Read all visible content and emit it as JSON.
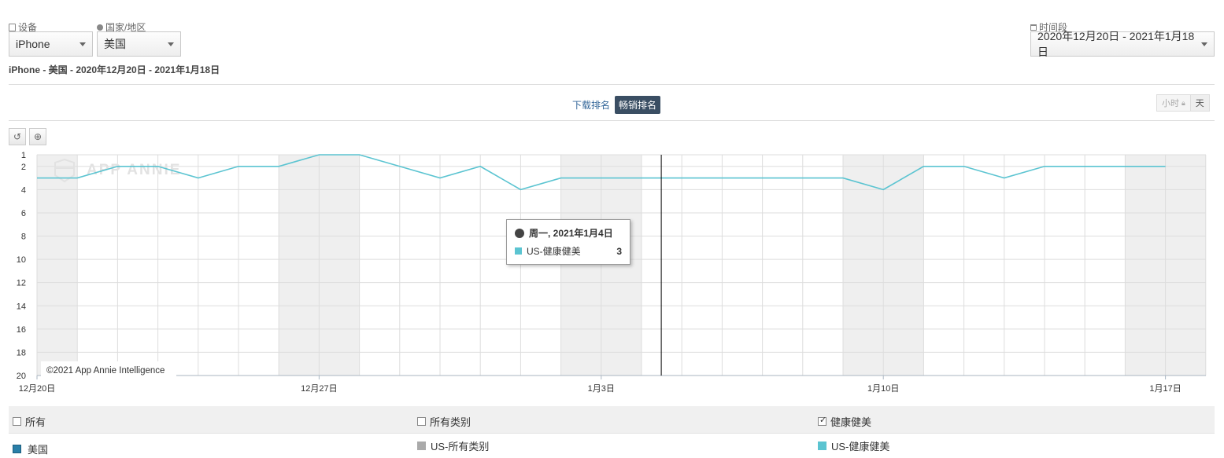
{
  "filters": {
    "device": {
      "label": "设备",
      "value": "iPhone"
    },
    "country": {
      "label": "国家/地区",
      "value": "美国"
    },
    "period": {
      "label": "时间段",
      "value": "2020年12月20日 - 2021年1月18日"
    }
  },
  "subtitle": "iPhone - 美国 - 2020年12月20日 - 2021年1月18日",
  "rank_toggle": {
    "downloads": "下载排名",
    "grossing": "畅销排名"
  },
  "granularity": {
    "hour": "小时",
    "day": "天"
  },
  "watermark": "APP ANNIE",
  "copyright": "©2021 App Annie Intelligence",
  "tooltip": {
    "date": "周一, 2021年1月4日",
    "series": "US-健康健美",
    "value": "3"
  },
  "colors": {
    "series": "#5bc4d1",
    "accent": "#3a4e63"
  },
  "chart_data": {
    "type": "line",
    "x": [
      "2020-12-20",
      "2020-12-21",
      "2020-12-22",
      "2020-12-23",
      "2020-12-24",
      "2020-12-25",
      "2020-12-26",
      "2020-12-27",
      "2020-12-28",
      "2020-12-29",
      "2020-12-30",
      "2020-12-31",
      "2021-01-01",
      "2021-01-02",
      "2021-01-03",
      "2021-01-04",
      "2021-01-05",
      "2021-01-06",
      "2021-01-07",
      "2021-01-08",
      "2021-01-09",
      "2021-01-10",
      "2021-01-11",
      "2021-01-12",
      "2021-01-13",
      "2021-01-14",
      "2021-01-15",
      "2021-01-16",
      "2021-01-17"
    ],
    "series": [
      {
        "name": "US-健康健美",
        "values": [
          3,
          3,
          2,
          2,
          3,
          2,
          2,
          1,
          1,
          2,
          3,
          2,
          4,
          3,
          3,
          3,
          3,
          3,
          3,
          3,
          3,
          4,
          2,
          2,
          3,
          2,
          2,
          2,
          2
        ]
      }
    ],
    "xticks": [
      "12月20日",
      "12月27日",
      "1月3日",
      "1月10日",
      "1月17日"
    ],
    "yticks": [
      "1",
      "2",
      "4",
      "6",
      "8",
      "10",
      "12",
      "14",
      "16",
      "18",
      "20"
    ],
    "ylim": [
      1,
      20
    ],
    "y_inverted": true,
    "grid": true
  },
  "legend": {
    "headers": [
      {
        "label": "所有",
        "checked": false
      },
      {
        "label": "所有类别",
        "checked": false
      },
      {
        "label": "健康健美",
        "checked": true
      }
    ],
    "rows": [
      {
        "label": "美国",
        "color": "#2a7fa8"
      },
      {
        "label": "US-所有类别",
        "color": "#aaaaaa"
      },
      {
        "label": "US-健康健美",
        "color": "#5bc4d1"
      }
    ]
  }
}
